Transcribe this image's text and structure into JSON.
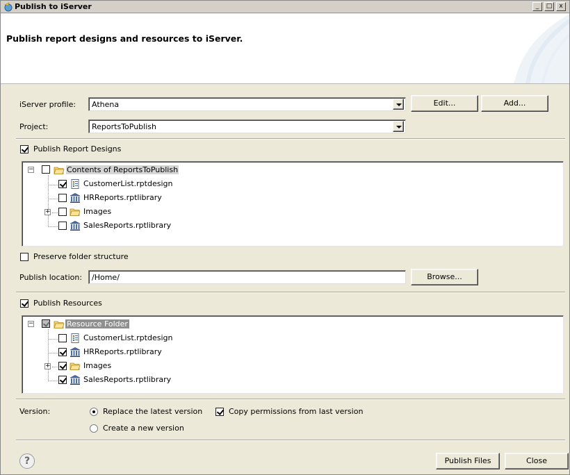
{
  "window": {
    "title": "Publish to iServer",
    "minimize_glyph": "_",
    "maximize_glyph": "□",
    "close_glyph": "x"
  },
  "header": {
    "description": "Publish report designs and resources to iServer."
  },
  "profile": {
    "label": "iServer profile:",
    "value": "Athena",
    "edit_label": "Edit...",
    "add_label": "Add..."
  },
  "project": {
    "label": "Project:",
    "value": "ReportsToPublish"
  },
  "designs": {
    "label": "Publish Report Designs",
    "checked": true,
    "root": {
      "label": "Contents of ReportsToPublish",
      "checked": false
    },
    "items": [
      {
        "label": "CustomerList.rptdesign",
        "icon": "report-design-icon",
        "checked": true
      },
      {
        "label": "HRReports.rptlibrary",
        "icon": "library-icon",
        "checked": false
      },
      {
        "label": "Images",
        "icon": "folder-icon",
        "checked": false,
        "expandable": true
      },
      {
        "label": "SalesReports.rptlibrary",
        "icon": "library-icon",
        "checked": false
      }
    ]
  },
  "preserve": {
    "label": "Preserve folder structure",
    "checked": false
  },
  "location": {
    "label": "Publish location:",
    "value": "/Home/",
    "browse_label": "Browse..."
  },
  "resources": {
    "label": "Publish Resources",
    "checked": true,
    "root": {
      "label": "Resource Folder",
      "checked": true,
      "grayed": true
    },
    "items": [
      {
        "label": "CustomerList.rptdesign",
        "icon": "report-design-icon",
        "checked": false
      },
      {
        "label": "HRReports.rptlibrary",
        "icon": "library-icon",
        "checked": true
      },
      {
        "label": "Images",
        "icon": "folder-icon",
        "checked": true,
        "expandable": true
      },
      {
        "label": "SalesReports.rptlibrary",
        "icon": "library-icon",
        "checked": true
      }
    ]
  },
  "version": {
    "label": "Version:",
    "replace_label": "Replace the latest version",
    "replace_selected": true,
    "copy_permissions_label": "Copy permissions from last version",
    "copy_permissions_checked": true,
    "new_label": "Create a new version",
    "new_selected": false
  },
  "footer": {
    "help_glyph": "?",
    "publish_label": "Publish Files",
    "close_label": "Close"
  }
}
